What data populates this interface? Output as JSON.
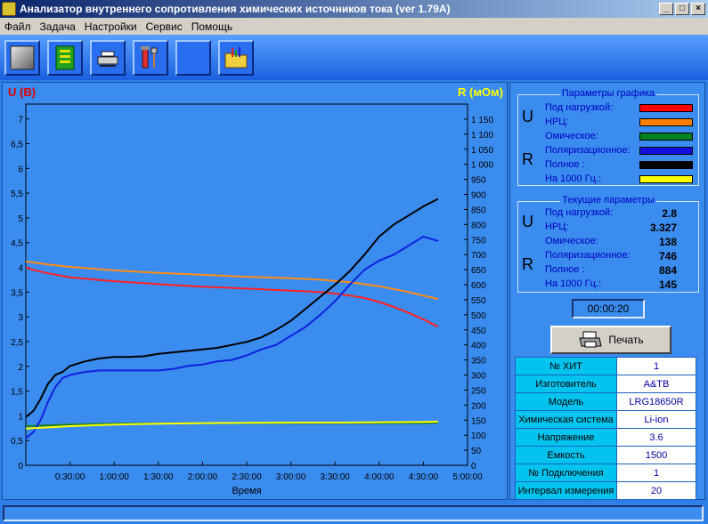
{
  "window": {
    "title": "Анализатор внутреннего сопротивления химических источников тока (ver 1.79A)"
  },
  "menu": [
    {
      "label": "Файл"
    },
    {
      "label": "Задача"
    },
    {
      "label": "Настройки"
    },
    {
      "label": "Сервис"
    },
    {
      "label": "Помощь"
    }
  ],
  "toolbar": [
    {
      "name": "measure-button",
      "icon": "gray-square-icon"
    },
    {
      "name": "board-button",
      "icon": "circuit-board-icon"
    },
    {
      "name": "device-button",
      "icon": "device-icon"
    },
    {
      "name": "tools-button",
      "icon": "tools-icon"
    },
    {
      "name": "blank-button",
      "icon": ""
    },
    {
      "name": "open-button",
      "icon": "folder-chart-icon"
    }
  ],
  "chart_data": {
    "type": "line",
    "y_left_label": "U (В)",
    "y_right_label": "R (мОм)",
    "xlabel": "Время",
    "x_ticks": [
      "0:30:00",
      "1:00:00",
      "1:30:00",
      "2:00:00",
      "2:30:00",
      "3:00:00",
      "3:30:00",
      "4:00:00",
      "4:30:00",
      "5:00:00"
    ],
    "y_left_ticks": [
      "0",
      "0,5",
      "1",
      "1,5",
      "2",
      "2,5",
      "3",
      "3,5",
      "4",
      "4,5",
      "5",
      "5,5",
      "6",
      "6,5",
      "7"
    ],
    "y_right_ticks": [
      "0",
      "50",
      "100",
      "150",
      "200",
      "250",
      "300",
      "350",
      "400",
      "450",
      "500",
      "550",
      "600",
      "650",
      "700",
      "750",
      "800",
      "850",
      "900",
      "950",
      "1 000",
      "1 050",
      "1 100",
      "1 150"
    ],
    "xlim_min": [
      0,
      300
    ],
    "ylim_left": [
      0,
      7.3
    ],
    "ylim_right": [
      0,
      1200
    ],
    "series": [
      {
        "name": "Под нагрузкой",
        "axis": "left",
        "color": "#ff2020",
        "x": [
          0,
          5,
          15,
          30,
          60,
          90,
          120,
          150,
          180,
          200,
          210,
          220,
          230,
          240,
          250,
          260,
          270,
          280
        ],
        "y": [
          4.0,
          3.95,
          3.88,
          3.8,
          3.72,
          3.66,
          3.61,
          3.57,
          3.53,
          3.5,
          3.47,
          3.43,
          3.38,
          3.3,
          3.2,
          3.08,
          2.95,
          2.8
        ]
      },
      {
        "name": "НРЦ",
        "axis": "left",
        "color": "#ff8c10",
        "x": [
          0,
          15,
          30,
          60,
          90,
          120,
          150,
          180,
          200,
          220,
          240,
          260,
          280
        ],
        "y": [
          4.12,
          4.06,
          4.01,
          3.94,
          3.89,
          3.85,
          3.81,
          3.78,
          3.75,
          3.7,
          3.62,
          3.5,
          3.36
        ]
      },
      {
        "name": "Омическое",
        "axis": "right",
        "color": "#208020",
        "x": [
          0,
          30,
          60,
          90,
          120,
          150,
          180,
          210,
          240,
          270,
          280
        ],
        "y": [
          130,
          135,
          138,
          139,
          140,
          140,
          140,
          140,
          140,
          140,
          141
        ]
      },
      {
        "name": "Поляризационное",
        "axis": "right",
        "color": "#1020e0",
        "x": [
          0,
          5,
          10,
          15,
          20,
          25,
          30,
          40,
          50,
          60,
          70,
          80,
          90,
          100,
          110,
          120,
          130,
          140,
          150,
          160,
          170,
          180,
          190,
          200,
          210,
          220,
          230,
          240,
          250,
          260,
          270,
          280
        ],
        "y": [
          90,
          110,
          150,
          210,
          260,
          290,
          300,
          310,
          315,
          315,
          315,
          315,
          315,
          320,
          330,
          335,
          345,
          350,
          365,
          385,
          400,
          430,
          460,
          500,
          545,
          600,
          650,
          680,
          700,
          730,
          760,
          745
        ]
      },
      {
        "name": "Полное",
        "axis": "right",
        "color": "#000000",
        "x": [
          0,
          5,
          10,
          15,
          20,
          25,
          30,
          40,
          50,
          60,
          70,
          80,
          90,
          100,
          110,
          120,
          130,
          140,
          150,
          160,
          170,
          180,
          190,
          200,
          210,
          220,
          230,
          240,
          250,
          260,
          270,
          280
        ],
        "y": [
          160,
          180,
          220,
          270,
          300,
          310,
          330,
          345,
          355,
          360,
          360,
          362,
          370,
          375,
          380,
          385,
          390,
          400,
          410,
          425,
          450,
          480,
          520,
          560,
          600,
          645,
          700,
          760,
          800,
          830,
          860,
          885
        ]
      },
      {
        "name": "На 1000 Гц.",
        "axis": "right",
        "color": "#ffff00",
        "x": [
          0,
          30,
          60,
          90,
          120,
          150,
          180,
          210,
          240,
          270,
          280
        ],
        "y": [
          122,
          130,
          135,
          138,
          140,
          141,
          142,
          142,
          143,
          144,
          145
        ]
      }
    ]
  },
  "graph_params": {
    "title": "Параметры графика",
    "u_letter": "U",
    "r_letter": "R",
    "u_items": [
      {
        "label": "Под нагрузкой:",
        "color": "#ff0000"
      },
      {
        "label": "НРЦ:",
        "color": "#ff8000"
      }
    ],
    "r_items": [
      {
        "label": "Омическое:",
        "color": "#008020"
      },
      {
        "label": "Поляризационное:",
        "color": "#1010e0"
      },
      {
        "label": "Полное :",
        "color": "#000000"
      },
      {
        "label": "На 1000 Гц.:",
        "color": "#ffff00"
      }
    ]
  },
  "current_params": {
    "title": "Текущие параметры",
    "u_letter": "U",
    "r_letter": "R",
    "u_items": [
      {
        "label": "Под нагрузкой:",
        "value": "2.8"
      },
      {
        "label": "НРЦ:",
        "value": "3.327"
      }
    ],
    "r_items": [
      {
        "label": "Омическое:",
        "value": "138"
      },
      {
        "label": "Поляризационное:",
        "value": "746"
      },
      {
        "label": "Полное :",
        "value": "884"
      },
      {
        "label": "На 1000 Гц.:",
        "value": "145"
      }
    ]
  },
  "timer": "00:00:20",
  "print_button": {
    "label": "Печать"
  },
  "info": [
    {
      "key": "№ ХИТ",
      "value": "1"
    },
    {
      "key": "Изготовитель",
      "value": "A&TB"
    },
    {
      "key": "Модель",
      "value": "LRG18650R"
    },
    {
      "key": "Химическая система",
      "value": "Li-ion"
    },
    {
      "key": "Напряжение",
      "value": "3.6"
    },
    {
      "key": "Емкость",
      "value": "1500"
    },
    {
      "key": "№ Подключения",
      "value": "1"
    },
    {
      "key": "Интервал измерения",
      "value": "20"
    }
  ]
}
